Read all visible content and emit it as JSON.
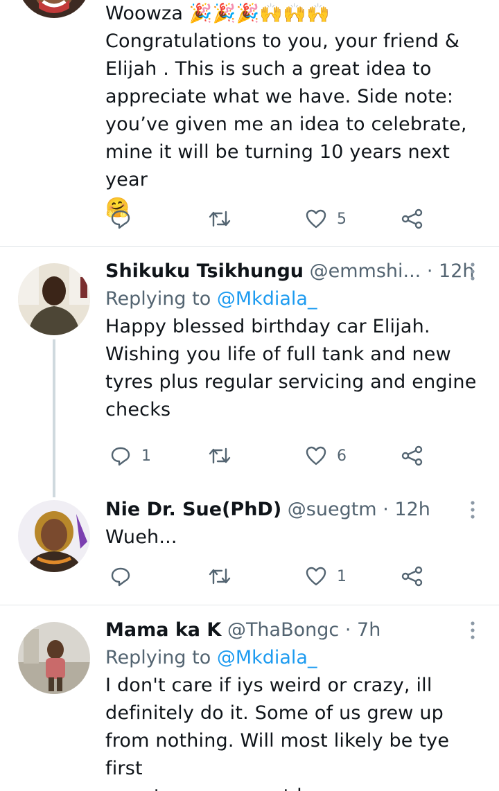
{
  "tweets": [
    {
      "body_lines": [
        "Woowza 🎉🎉🎉🙌🙌🙌",
        "Congratulations to you, your friend &",
        "Elijah . This is such a great idea to",
        "appreciate what we have. Side note:",
        "you’ve given me an idea to celebrate,",
        "mine it will be turning 10 years next year",
        "🤗"
      ],
      "reply_count": "",
      "retweet_count": "",
      "like_count": "5"
    },
    {
      "name": "Shikuku Tsikhungu",
      "handle": "@emmshi...",
      "dot": "·",
      "time": "12h",
      "replying_prefix": "Replying to ",
      "replying_handle": "@Mkdiala_",
      "body_lines": [
        "Happy blessed birthday car Elijah.",
        "Wishing you life of full tank and new",
        "tyres plus regular servicing and engine",
        "checks"
      ],
      "reply_count": "1",
      "retweet_count": "",
      "like_count": "6"
    },
    {
      "name": "Nie Dr. Sue(PhD)",
      "handle": "@suegtm",
      "dot": "·",
      "time": "12h",
      "body_lines": [
        "Wueh..."
      ],
      "reply_count": "",
      "retweet_count": "",
      "like_count": "1"
    },
    {
      "name": "Mama ka K",
      "handle": "@ThaBongc",
      "dot": "·",
      "time": "7h",
      "replying_prefix": "Replying to ",
      "replying_handle": "@Mkdiala_",
      "body_lines": [
        "I don't care if iys weird or crazy, ill",
        "definitely do it. Some of us grew up",
        "from nothing. Will most likely be tye first",
        "ever to owna car at home."
      ]
    }
  ],
  "icons": {
    "reply": "reply-bubble-icon",
    "retweet": "retweet-icon",
    "like": "heart-icon",
    "share": "share-icon",
    "more": "more-vertical-icon"
  },
  "colors": {
    "link": "#1d9bf0",
    "secondary_text": "#536471",
    "divider": "#e1e5e8",
    "thread_line": "#cfd9de"
  }
}
